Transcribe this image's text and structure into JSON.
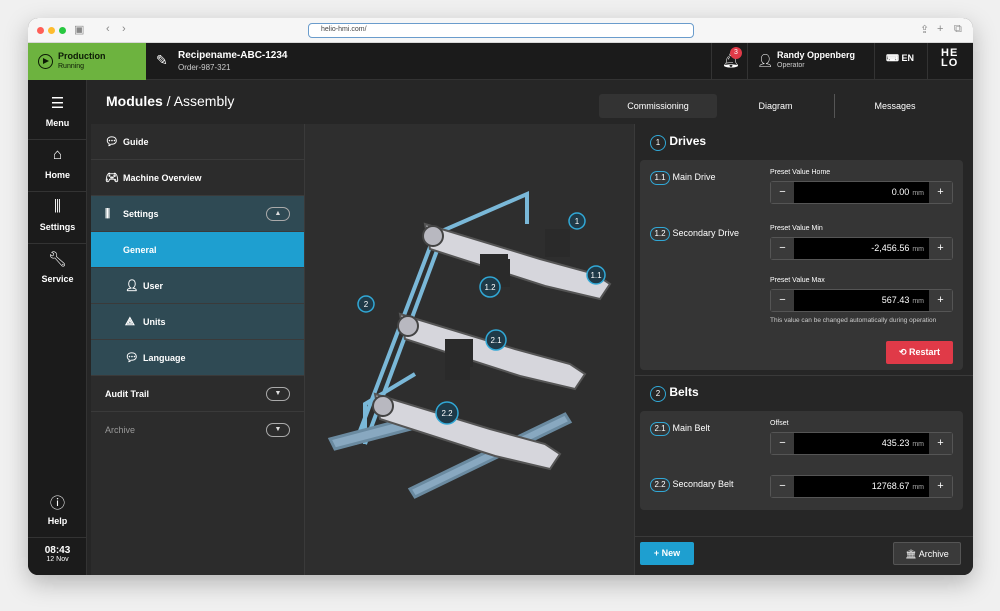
{
  "browser": {
    "url": "helio-hmi.com/"
  },
  "status": {
    "title": "Production",
    "state": "Running"
  },
  "recipe": {
    "name": "Recipename-ABC-1234",
    "order": "Order-987-321"
  },
  "notifications": {
    "count": "3"
  },
  "user": {
    "name": "Randy Oppenberg",
    "role": "Operator"
  },
  "language": "EN",
  "logo": "HE LO",
  "nav": {
    "menu": "Menu",
    "home": "Home",
    "settings": "Settings",
    "service": "Service",
    "help": "Help"
  },
  "clock": {
    "time": "08:43",
    "date": "12 Nov"
  },
  "page": {
    "title": "Modules",
    "subtitle": "Assembly"
  },
  "tabs": [
    "Commissioning",
    "Diagram",
    "Messages"
  ],
  "menu": {
    "guide": "Guide",
    "overview": "Machine Overview",
    "settings": "Settings",
    "general": "General",
    "user": "User",
    "units": "Units",
    "language": "Language",
    "audit": "Audit Trail",
    "archive": "Archive"
  },
  "image_labels": [
    "1",
    "1.1",
    "1.2",
    "2",
    "2.1",
    "2.2"
  ],
  "drives": {
    "num": "1",
    "title": "Drives",
    "main": {
      "num": "1.1",
      "label": "Main Drive"
    },
    "secondary": {
      "num": "1.2",
      "label": "Secondary Drive"
    },
    "home": {
      "label": "Preset Value Home",
      "value": "0.00",
      "unit": "mm"
    },
    "min": {
      "label": "Preset Value Min",
      "value": "-2,456.56",
      "unit": "mm"
    },
    "max": {
      "label": "Preset Value Max",
      "value": "567.43",
      "unit": "mm"
    },
    "note": "This value can be changed automatically during operation",
    "restart": "Restart"
  },
  "belts": {
    "num": "2",
    "title": "Belts",
    "main": {
      "num": "2.1",
      "label": "Main Belt"
    },
    "secondary": {
      "num": "2.2",
      "label": "Secondary Belt"
    },
    "offset": {
      "label": "Offset",
      "value": "435.23",
      "unit": "mm"
    },
    "secondary_value": {
      "value": "12768.67",
      "unit": "mm"
    }
  },
  "actions": {
    "new": "New",
    "archive": "Archive"
  },
  "colors": {
    "production": "#6db33f",
    "accent": "#1e9fd0",
    "restart": "#e03a48"
  }
}
